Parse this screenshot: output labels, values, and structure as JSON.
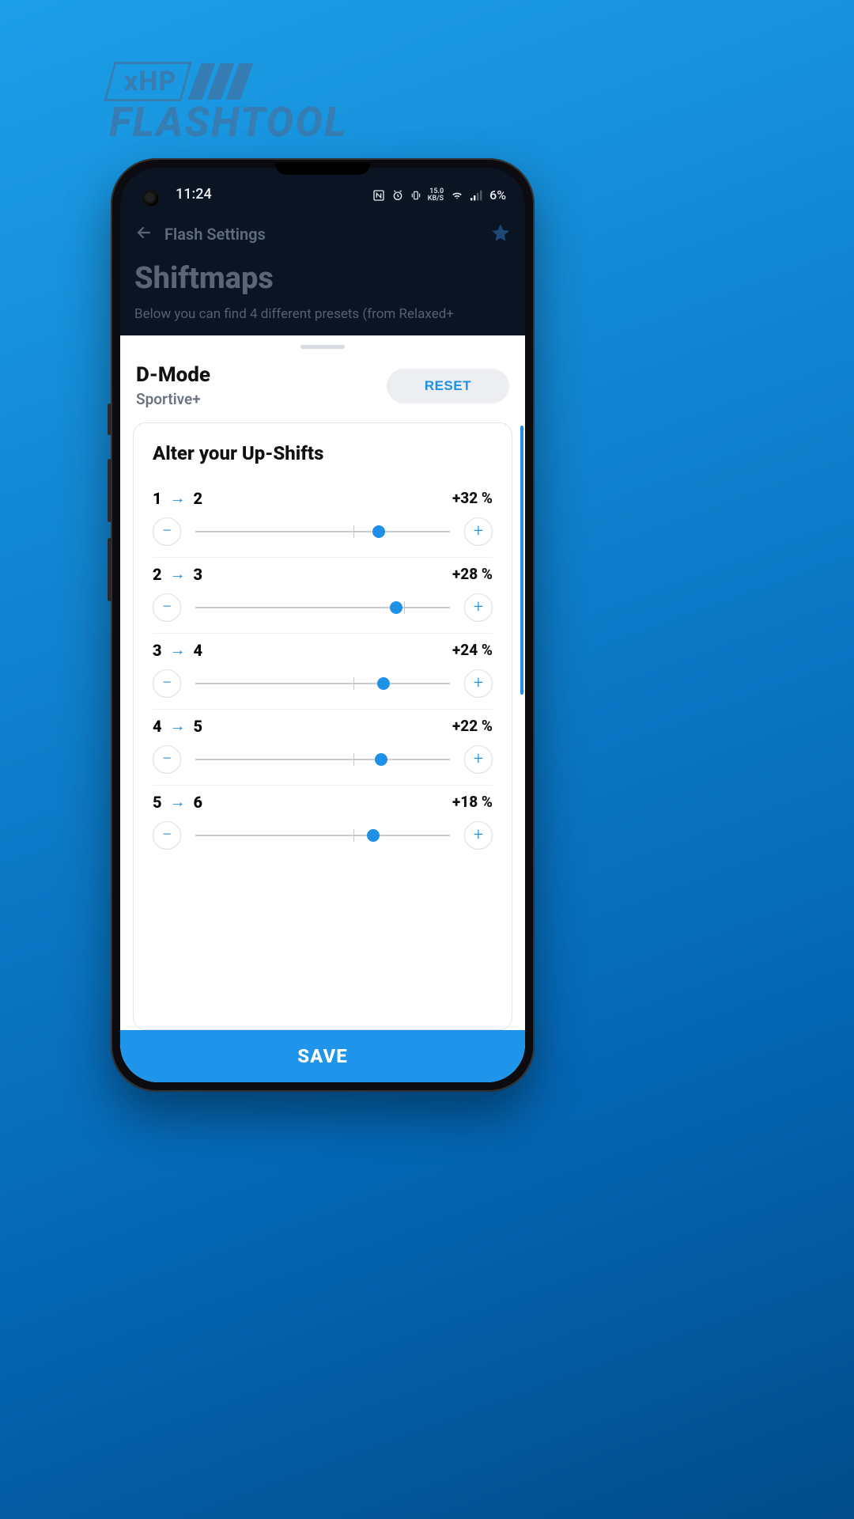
{
  "logo": {
    "badge": "xHP",
    "word": "FLASHTOOL"
  },
  "status": {
    "time": "11:24",
    "speed_top": "15.0",
    "speed_bot": "KB/S",
    "battery": "6%"
  },
  "header": {
    "back_title": "Flash Settings",
    "page_title": "Shiftmaps",
    "subtitle": "Below you can find 4 different presets (from Relaxed+"
  },
  "sheet": {
    "mode_title": "D-Mode",
    "mode_sub": "Sportive+",
    "reset": "RESET",
    "card_title": "Alter your Up-Shifts"
  },
  "shifts": [
    {
      "from": "1",
      "to": "2",
      "pct": "+32 %",
      "pos": 72,
      "tick": 62
    },
    {
      "from": "2",
      "to": "3",
      "pct": "+28 %",
      "pos": 79,
      "tick": 82
    },
    {
      "from": "3",
      "to": "4",
      "pct": "+24 %",
      "pos": 74,
      "tick": 62
    },
    {
      "from": "4",
      "to": "5",
      "pct": "+22 %",
      "pos": 73,
      "tick": 62
    },
    {
      "from": "5",
      "to": "6",
      "pct": "+18 %",
      "pos": 70,
      "tick": 62
    }
  ],
  "save": "SAVE"
}
